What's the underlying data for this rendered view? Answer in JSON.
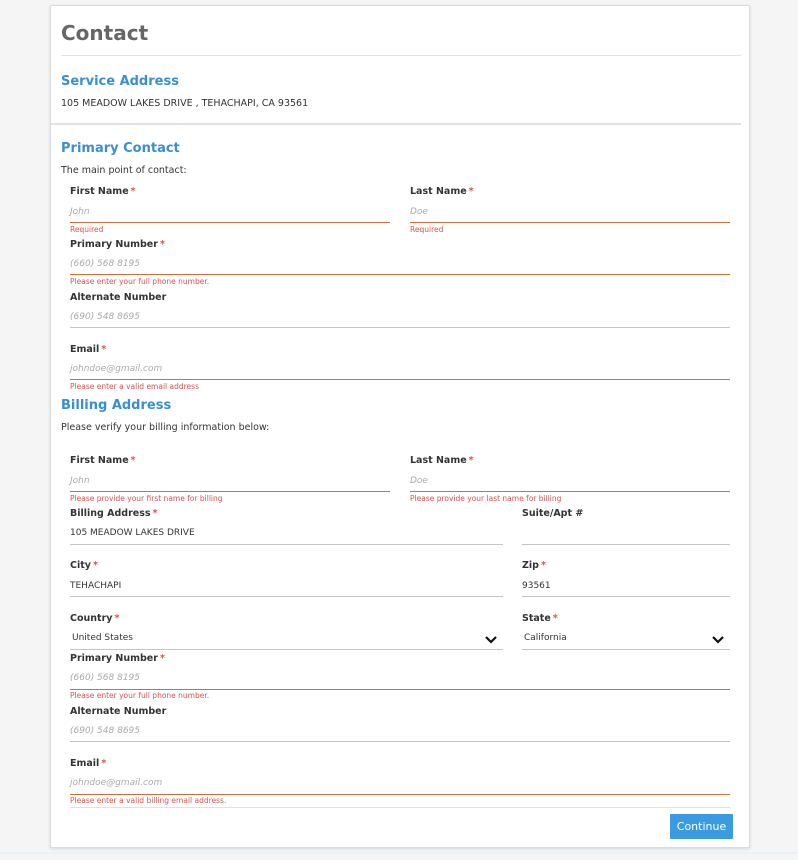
{
  "page": {
    "title": "Contact"
  },
  "service": {
    "title": "Service Address",
    "address": "105 MEADOW LAKES DRIVE , TEHACHAPI, CA 93561"
  },
  "primary": {
    "title": "Primary Contact",
    "subtitle": "The main point of contact:",
    "first_name": {
      "label": "First Name",
      "placeholder": "John",
      "error": "Required"
    },
    "last_name": {
      "label": "Last Name",
      "placeholder": "Doe",
      "error": "Required"
    },
    "primary_number": {
      "label": "Primary Number",
      "placeholder": "(660) 568 8195",
      "error": "Please enter your full phone number."
    },
    "alternate_number": {
      "label": "Alternate Number",
      "placeholder": "(690) 548 8695"
    },
    "email": {
      "label": "Email",
      "placeholder": "johndoe@gmail.com",
      "error": "Please enter a valid email address"
    }
  },
  "billing": {
    "title": "Billing Address",
    "subtitle": "Please verify your billing information below:",
    "first_name": {
      "label": "First Name",
      "placeholder": "John",
      "error": "Please provide your first name for billing"
    },
    "last_name": {
      "label": "Last Name",
      "placeholder": "Doe",
      "error": "Please provide your last name for billing"
    },
    "address": {
      "label": "Billing Address",
      "value": "105 MEADOW LAKES DRIVE"
    },
    "suite": {
      "label": "Suite/Apt #",
      "value": ""
    },
    "city": {
      "label": "City",
      "value": "TEHACHAPI"
    },
    "zip": {
      "label": "Zip",
      "value": "93561"
    },
    "country": {
      "label": "Country",
      "value": "United States"
    },
    "state": {
      "label": "State",
      "value": "California"
    },
    "primary_number": {
      "label": "Primary Number",
      "placeholder": "(660) 568 8195",
      "error": "Please enter your full phone number."
    },
    "alternate_number": {
      "label": "Alternate Number",
      "placeholder": "(690) 548 8695"
    },
    "email": {
      "label": "Email",
      "placeholder": "johndoe@gmail.com",
      "error": "Please enter a valid billing email address."
    }
  },
  "actions": {
    "continue_label": "Continue"
  },
  "colors": {
    "accent": "#3a8fd3",
    "error": "#d9534f",
    "error_underline": "#d96b3a",
    "button": "#3a9be0"
  },
  "icons": {
    "select": "chevron-down-icon"
  },
  "required_marker": "*"
}
